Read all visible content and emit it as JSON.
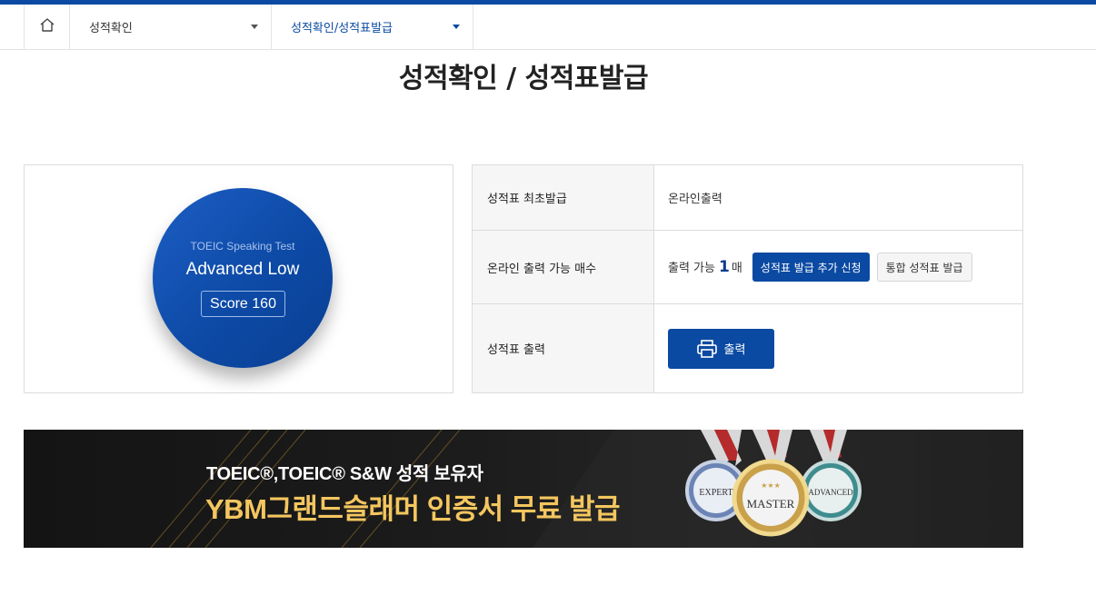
{
  "breadcrumb": {
    "home_icon": "home-icon",
    "level1": "성적확인",
    "level2": "성적확인/성적표발급"
  },
  "page_title": "성적확인 / 성적표발급",
  "score_card": {
    "test_name": "TOEIC Speaking Test",
    "level": "Advanced Low",
    "score": "Score 160"
  },
  "info_table": {
    "rows": [
      {
        "label": "성적표 최초발급",
        "value": "온라인출력"
      },
      {
        "label": "온라인 출력 가능 매수",
        "prefix": "출력 가능",
        "count": "1",
        "unit": "매",
        "btn_additional": "성적표 발급 추가 신청",
        "btn_integrated": "통합 성적표 발급"
      },
      {
        "label": "성적표 출력",
        "btn_print": "출력",
        "print_icon": "printer-icon"
      }
    ]
  },
  "banner": {
    "line1": "TOEIC®,TOEIC® S&W 성적 보유자",
    "line2": "YBM그랜드슬래머 인증서 무료 발급",
    "medals": [
      "EXPERT",
      "MASTER",
      "ADVANCED"
    ],
    "colors": {
      "gold": "#f4c65f"
    }
  },
  "colors": {
    "brand": "#0b4aa2"
  }
}
